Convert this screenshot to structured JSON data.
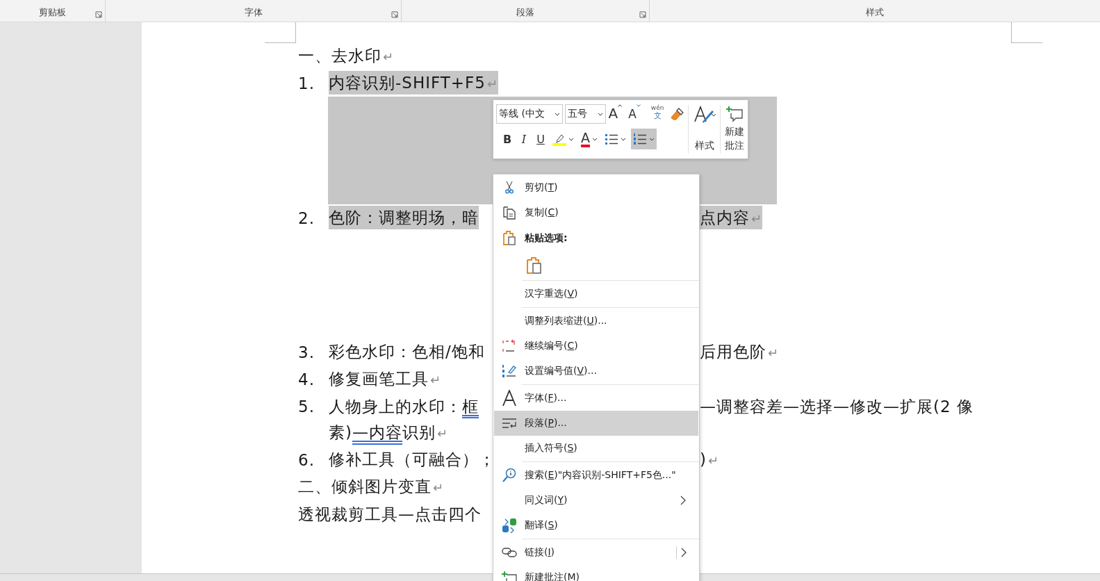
{
  "ribbon": {
    "groups": [
      {
        "label": "剪贴板",
        "launcher": true
      },
      {
        "label": "字体",
        "launcher": true
      },
      {
        "label": "段落",
        "launcher": true
      },
      {
        "label": "样式",
        "launcher": false
      }
    ]
  },
  "document": {
    "lines": [
      {
        "kind": "heading",
        "selected": false,
        "left": [
          {
            "kind": "text",
            "text": "一、去水印"
          },
          {
            "kind": "mark",
            "text": "↵"
          }
        ]
      },
      {
        "kind": "numbered",
        "number": "1.",
        "selected": true,
        "left": [
          {
            "kind": "text",
            "text": "内容识别-SHIFT+F5"
          },
          {
            "kind": "mark",
            "text": "↵"
          }
        ],
        "area_after": {
          "selected": true
        }
      },
      {
        "kind": "numbered",
        "number": "2.",
        "selected": true,
        "left": [
          {
            "kind": "text",
            "text": "色阶：调整明场，暗"
          }
        ],
        "right": [
          {
            "kind": "text",
            "text": "点内容"
          },
          {
            "kind": "mark",
            "text": "↵"
          }
        ],
        "area_after": {
          "selected": false
        }
      },
      {
        "kind": "numbered",
        "number": "3.",
        "selected": false,
        "left": [
          {
            "kind": "text",
            "text": "彩色水印：色相/饱和"
          }
        ],
        "right": [
          {
            "kind": "text",
            "text": "后用色阶"
          },
          {
            "kind": "mark",
            "text": "↵"
          }
        ]
      },
      {
        "kind": "numbered",
        "number": "4.",
        "selected": false,
        "left": [
          {
            "kind": "text",
            "text": "修复画笔工具"
          },
          {
            "kind": "mark",
            "text": "↵"
          }
        ]
      },
      {
        "kind": "numbered",
        "number": "5.",
        "selected": false,
        "left": [
          {
            "kind": "text",
            "text": "人物身上的水印："
          },
          {
            "kind": "underlined",
            "text": "框"
          }
        ],
        "right": [
          {
            "kind": "text",
            "text": "—调整容差—选择—修改—扩展(2 像"
          }
        ]
      },
      {
        "kind": "continuation",
        "selected": false,
        "left": [
          {
            "kind": "text",
            "text": "素)"
          },
          {
            "kind": "underlined",
            "text": "—内容"
          },
          {
            "kind": "text",
            "text": "识别"
          },
          {
            "kind": "mark",
            "text": "↵"
          }
        ]
      },
      {
        "kind": "numbered",
        "number": "6.",
        "selected": false,
        "left": [
          {
            "kind": "text",
            "text": "修补工具（可融合）；"
          }
        ],
        "right": [
          {
            "kind": "text",
            "text": ")"
          },
          {
            "kind": "mark",
            "text": "↵"
          }
        ]
      },
      {
        "kind": "heading",
        "selected": false,
        "left": [
          {
            "kind": "text",
            "text": "二、倾斜图片变直"
          },
          {
            "kind": "mark",
            "text": "↵"
          }
        ]
      },
      {
        "kind": "heading",
        "selected": false,
        "left": [
          {
            "kind": "text",
            "text": "透视裁剪工具—点击四个"
          }
        ]
      }
    ]
  },
  "mini_toolbar": {
    "font": {
      "value": "等线 (中文"
    },
    "size": {
      "value": "五号"
    },
    "tools": [
      {
        "kind": "grow",
        "label": "A"
      },
      {
        "kind": "shrink",
        "label": "A"
      },
      {
        "kind": "phonetic",
        "label": "wén",
        "sub": "文"
      },
      {
        "kind": "painter"
      }
    ],
    "format": [
      {
        "kind": "bold",
        "label": "B",
        "dropdown": false,
        "selected": false
      },
      {
        "kind": "italic",
        "label": "I",
        "dropdown": false,
        "selected": false
      },
      {
        "kind": "underline",
        "label": "U",
        "dropdown": false,
        "selected": false
      },
      {
        "kind": "highlight",
        "dropdown": true,
        "selected": false
      },
      {
        "kind": "font_color",
        "label": "A",
        "dropdown": true,
        "selected": false
      },
      {
        "kind": "bullets",
        "dropdown": true,
        "selected": false
      },
      {
        "kind": "numbering",
        "dropdown": true,
        "selected": true
      }
    ],
    "styles": {
      "label": "样式"
    },
    "comment": {
      "label": "新建批注"
    }
  },
  "context_menu": {
    "items": [
      {
        "kind": "item",
        "before": "剪切(",
        "key": "T",
        "after": ")",
        "selected": false,
        "submenu": false
      },
      {
        "kind": "item",
        "before": "复制(",
        "key": "C",
        "after": ")",
        "selected": false,
        "submenu": false
      },
      {
        "kind": "header",
        "before": "粘贴选项:",
        "selected": false,
        "submenu": false
      },
      {
        "kind": "paste_options",
        "selected": false
      },
      {
        "kind": "separator"
      },
      {
        "kind": "item",
        "before": "汉字重选(",
        "key": "V",
        "after": ")",
        "selected": false,
        "submenu": false
      },
      {
        "kind": "separator"
      },
      {
        "kind": "item",
        "before": "调整列表缩进(",
        "key": "U",
        "after": ")...",
        "selected": false,
        "submenu": false
      },
      {
        "kind": "item",
        "before": "继续编号(",
        "key": "C",
        "after": ")",
        "selected": false,
        "submenu": false
      },
      {
        "kind": "item",
        "before": "设置编号值(",
        "key": "V",
        "after": ")...",
        "selected": false,
        "submenu": false
      },
      {
        "kind": "separator"
      },
      {
        "kind": "item",
        "before": "字体(",
        "key": "F",
        "after": ")...",
        "selected": false,
        "submenu": false
      },
      {
        "kind": "item",
        "before": "段落(",
        "key": "P",
        "after": ")...",
        "selected": true,
        "submenu": false
      },
      {
        "kind": "item",
        "before": "插入符号(",
        "key": "S",
        "after": ")",
        "selected": false,
        "submenu": false
      },
      {
        "kind": "separator"
      },
      {
        "kind": "item",
        "before": "搜索(",
        "key": "E",
        "after": ")\"内容识别-SHIFT+F5色...\"",
        "selected": false,
        "submenu": false
      },
      {
        "kind": "item",
        "before": "同义词(",
        "key": "Y",
        "after": ")",
        "selected": false,
        "submenu": true
      },
      {
        "kind": "item",
        "before": "翻译(",
        "key": "S",
        "after": ")",
        "selected": false,
        "submenu": false
      },
      {
        "kind": "separator"
      },
      {
        "kind": "item",
        "before": "链接(",
        "key": "I",
        "after": ")",
        "selected": false,
        "submenu": true,
        "split": true
      },
      {
        "kind": "item",
        "before": "新建批注(",
        "key": "M",
        "after": ")",
        "selected": false,
        "submenu": false
      }
    ]
  }
}
